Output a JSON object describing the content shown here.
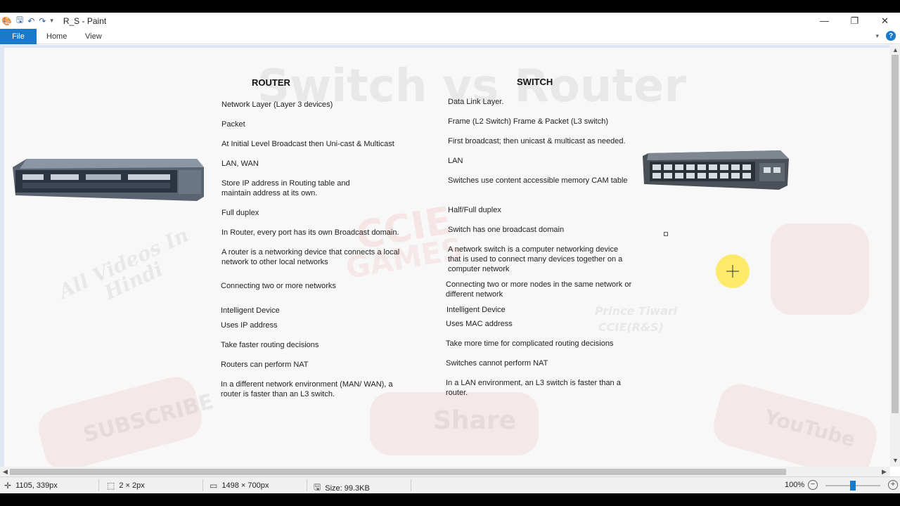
{
  "window": {
    "title": "R_S - Paint",
    "controls": {
      "minimize": "—",
      "maximize": "❐",
      "close": "✕"
    }
  },
  "quick_access": {
    "icons": [
      "paint-icon",
      "save-icon",
      "undo-icon",
      "redo-icon",
      "customize-icon"
    ]
  },
  "ribbon": {
    "file_label": "File",
    "tabs": [
      "Home",
      "View"
    ],
    "help_label": "?"
  },
  "canvas": {
    "watermark": {
      "big_title": "Switch  vs  Router",
      "ccie": "CCIE",
      "games": "GAMES",
      "all_videos": "All Videos In",
      "hindi": "Hindi",
      "prince": "Prince Tiwari",
      "ccie_rs": "CCIE(R&S)",
      "subscribe": "SUBSCRIBE",
      "share": "Share",
      "youtube": "YouTube"
    },
    "router_heading": "ROUTER",
    "switch_heading": "SWITCH",
    "router_rows": [
      "Network Layer (Layer 3 devices)",
      "Packet",
      "At Initial Level Broadcast then Uni-cast & Multicast",
      "LAN, WAN",
      "Store IP address in Routing table and\nmaintain address at its own.",
      "Full duplex",
      "In Router, every port has its own Broadcast domain.",
      "A router is a networking device that connects a local\nnetwork to other local networks",
      "Connecting two or more networks",
      "Intelligent Device",
      "Uses IP address",
      "Take faster routing decisions",
      "Routers can perform NAT",
      "In a different network environment (MAN/ WAN), a\nrouter is faster than an L3 switch."
    ],
    "switch_rows": [
      "Data Link Layer.",
      "Frame (L2 Switch) Frame & Packet (L3 switch)",
      "First broadcast; then unicast & multicast as needed.",
      "LAN",
      "Switches use content accessible memory CAM table",
      "Half/Full duplex",
      "Switch has one broadcast domain",
      "A network switch is a computer networking device\nthat is used to connect many devices together on a\ncomputer network",
      "Connecting two or more nodes in the same network or\ndifferent network",
      "Intelligent Device",
      "Uses MAC address",
      "Take more time for complicated routing decisions",
      "Switches cannot perform NAT",
      "In a LAN environment, an L3 switch is faster than a\nrouter."
    ]
  },
  "statusbar": {
    "cursor_pos": "1105, 339px",
    "selection_size": "2 × 2px",
    "image_size": "1498 × 700px",
    "file_size": "Size: 99.3KB",
    "zoom": "100%"
  },
  "colors": {
    "accent": "#1979ca",
    "cursor_highlight": "#ffe63c"
  }
}
